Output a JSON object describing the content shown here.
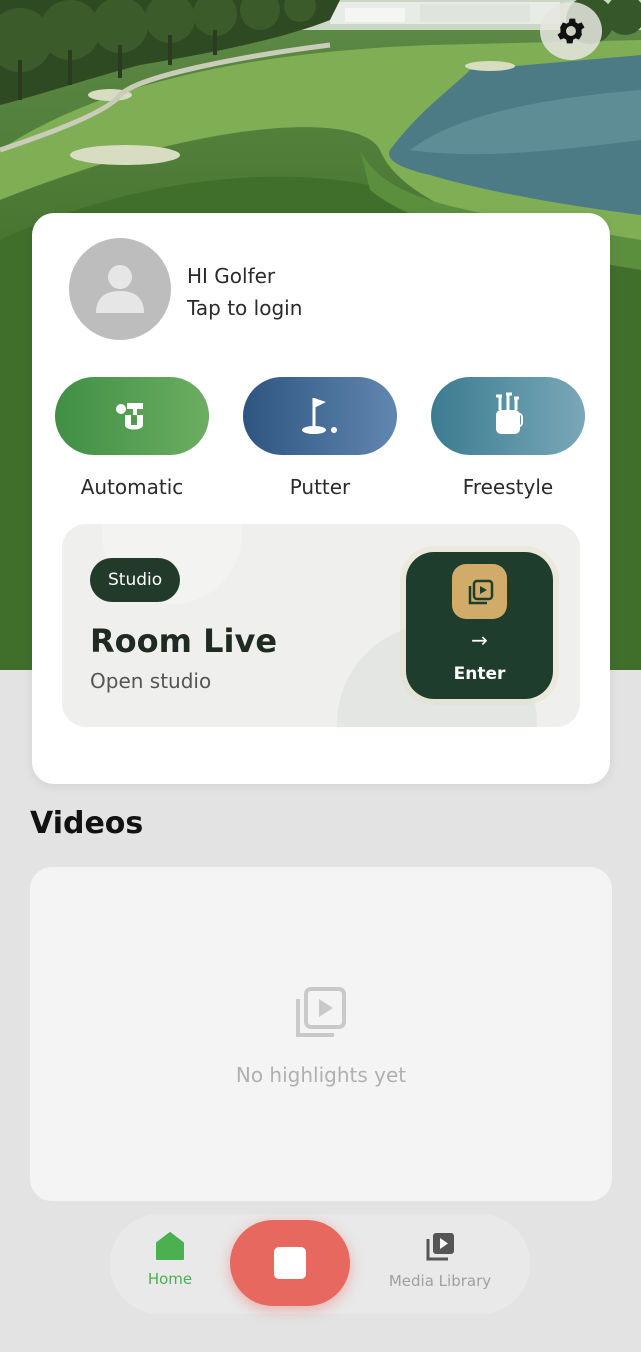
{
  "colors": {
    "accent_green": "#4caf50",
    "nav_inactive": "#a0a0a0",
    "record_button": "#e6685f",
    "studio_dark": "#213a2a",
    "studio_gold": "#d1ab6a"
  },
  "header": {
    "settings_icon": "gear-icon"
  },
  "profile": {
    "greeting": "HI Golfer",
    "login_prompt": "Tap to login",
    "avatar_icon": "user-icon"
  },
  "modes": [
    {
      "label": "Automatic",
      "icon": "auto-tee-icon"
    },
    {
      "label": "Putter",
      "icon": "flag-hole-icon"
    },
    {
      "label": "Freestyle",
      "icon": "golf-bag-icon"
    }
  ],
  "studio": {
    "badge": "Studio",
    "title": "Room Live",
    "subtitle": "Open studio",
    "enter_arrow": "→",
    "enter_label": "Enter",
    "enter_icon": "video-library-icon"
  },
  "videos": {
    "title": "Videos",
    "empty_text": "No highlights yet",
    "empty_icon": "video-library-icon"
  },
  "nav": {
    "home_label": "Home",
    "home_icon": "home-icon",
    "record_icon": "stop-icon",
    "media_label": "Media Library",
    "media_icon": "media-library-icon"
  }
}
